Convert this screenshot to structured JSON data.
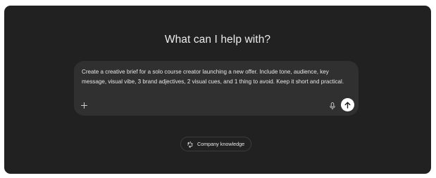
{
  "main": {
    "headline": "What can I help with?"
  },
  "composer": {
    "prompt_text": "Create a creative brief for a solo course creator launching a new offer. Include tone, audience, key message, visual vibe, 3 brand adjectives, 2 visual cues, and 1 thing to avoid. Keep it short and practical.",
    "icons": {
      "add": "plus-icon",
      "voice": "microphone-icon",
      "send": "arrow-up-icon"
    }
  },
  "knowledge": {
    "label": "Company knowledge",
    "icon": "recycle-icon"
  },
  "colors": {
    "background": "#212121",
    "composer": "#303030",
    "text": "#ececec",
    "send_button": "#ffffff"
  }
}
